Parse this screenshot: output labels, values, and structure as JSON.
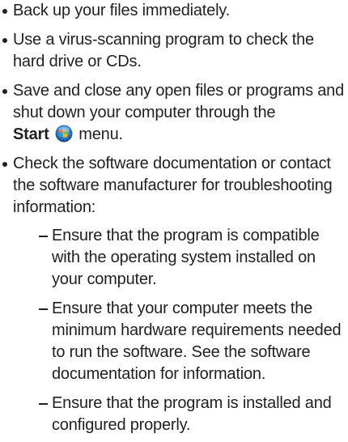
{
  "items": [
    {
      "text": "Back up your files immediately."
    },
    {
      "text": "Use a virus-scanning program to check the hard drive or CDs."
    },
    {
      "text_before": "Save and close any open files or programs and shut down your computer through the",
      "strong": "Start",
      "text_after": "menu.",
      "icon": "windows-start-icon"
    },
    {
      "text": "Check the software documentation or contact the software manufacturer for troubleshooting information:",
      "subitems": [
        {
          "text": "Ensure that the program is compatible with the operating system installed on your computer."
        },
        {
          "text": "Ensure that your computer meets the minimum hardware requirements needed to run the software. See the software documentation for information."
        },
        {
          "text": "Ensure that the program is installed and configured properly."
        }
      ]
    }
  ]
}
